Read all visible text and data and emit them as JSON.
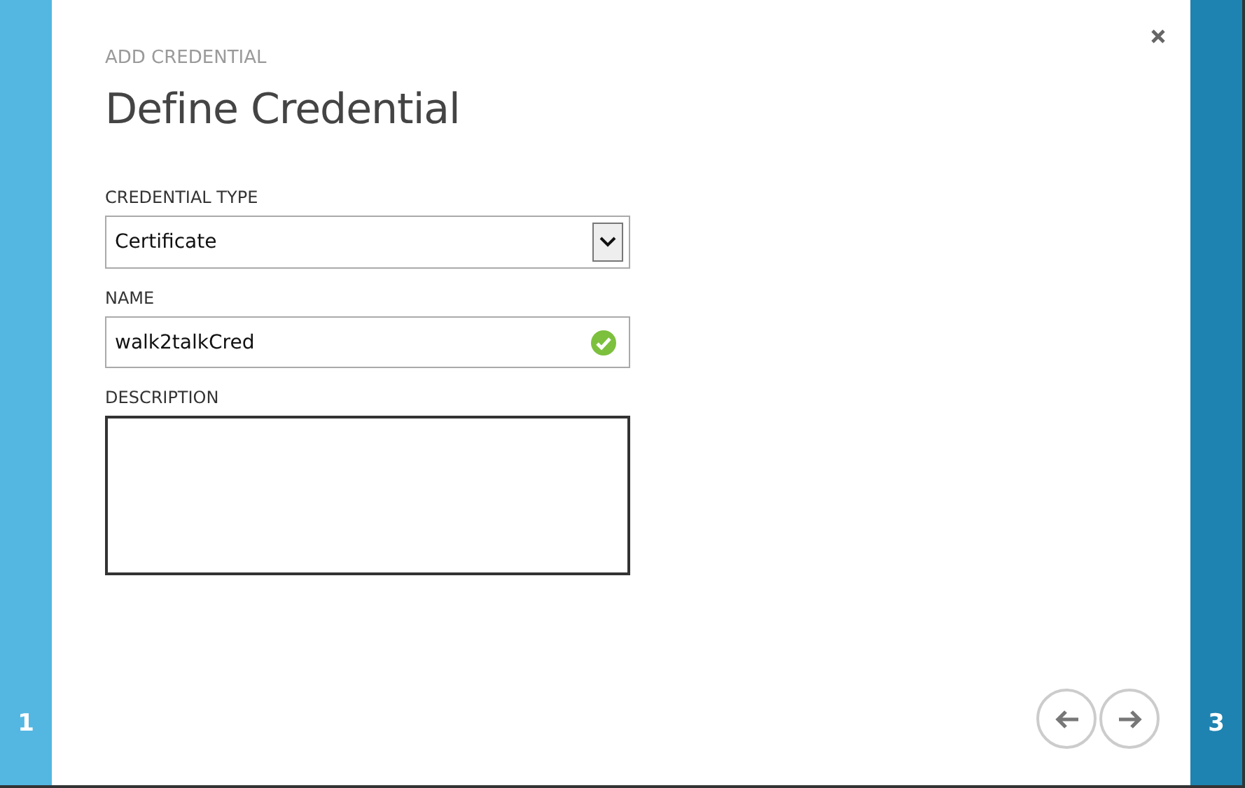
{
  "steps": [
    {
      "label": "1",
      "kind": "previous"
    },
    {
      "label": "3",
      "kind": "next"
    }
  ],
  "dialog": {
    "eyebrow": "ADD CREDENTIAL",
    "title": "Define Credential"
  },
  "fields": [
    {
      "label": "CREDENTIAL TYPE",
      "kind": "dropdown",
      "value": "Certificate"
    },
    {
      "label": "NAME",
      "kind": "text",
      "value": "walk2talkCred",
      "valid": true
    },
    {
      "label": "DESCRIPTION",
      "kind": "textarea"
    }
  ]
}
